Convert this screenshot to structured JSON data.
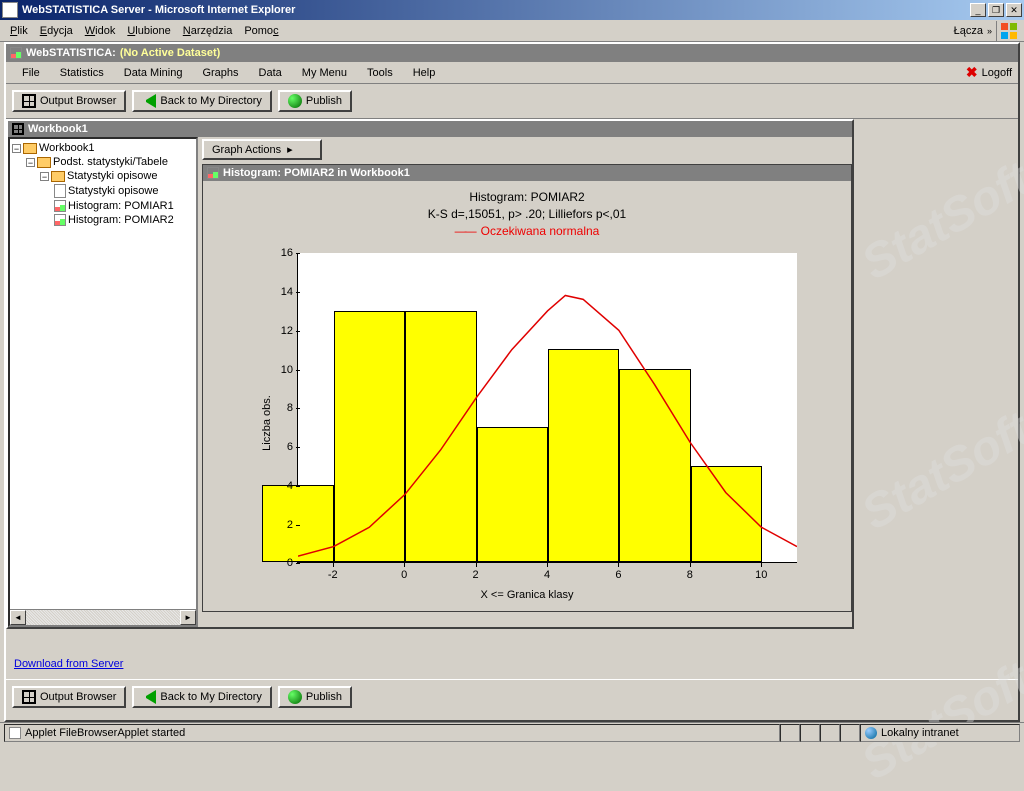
{
  "browser": {
    "title": "WebSTATISTICA Server - Microsoft Internet Explorer",
    "menu": [
      "Plik",
      "Edycja",
      "Widok",
      "Ulubione",
      "Narzędzia",
      "Pomoc"
    ],
    "links_label": "Łącza",
    "status_text": "Applet FileBrowserApplet started",
    "zone": "Lokalny intranet"
  },
  "app": {
    "title_prefix": "WebSTATISTICA:",
    "title_suffix": "(No Active Dataset)",
    "menu": [
      "File",
      "Statistics",
      "Data Mining",
      "Graphs",
      "Data",
      "My Menu",
      "Tools",
      "Help"
    ],
    "logoff": "Logoff"
  },
  "toolbar": {
    "output_browser": "Output Browser",
    "back": "Back to My Directory",
    "publish": "Publish"
  },
  "workbook": {
    "title": "Workbook1",
    "graph_actions": "Graph Actions",
    "tree": {
      "root": "Workbook1",
      "n1": "Podst. statystyki/Tabele",
      "n2": "Statystyki opisowe",
      "n3": "Statystyki opisowe",
      "n4": "Histogram: POMIAR1",
      "n5": "Histogram: POMIAR2"
    }
  },
  "graph": {
    "window_title": "Histogram: POMIAR2 in Workbook1",
    "title": "Histogram: POMIAR2",
    "subtitle": "K-S d=,15051, p> .20; Lilliefors p<,01",
    "legend": "Oczekiwana normalna",
    "ylabel": "Liczba obs.",
    "xlabel": "X <= Granica klasy"
  },
  "link": {
    "download": "Download from Server"
  },
  "watermark": "StatSoft",
  "chart_data": {
    "type": "bar",
    "categories": [
      -2,
      0,
      2,
      4,
      6,
      8,
      10
    ],
    "values": [
      4,
      13,
      13,
      7,
      11,
      10,
      5
    ],
    "title": "Histogram: POMIAR2",
    "xlabel": "X <= Granica klasy",
    "ylabel": "Liczba obs.",
    "ylim": [
      0,
      16
    ],
    "xlim": [
      -3,
      11
    ],
    "overlay": {
      "name": "Oczekiwana normalna",
      "type": "line",
      "color": "#e00000",
      "x": [
        -3,
        -2,
        -1,
        0,
        1,
        2,
        3,
        4,
        4.5,
        5,
        6,
        7,
        8,
        9,
        10,
        11
      ],
      "y": [
        0.3,
        0.8,
        1.8,
        3.5,
        5.8,
        8.5,
        11.0,
        13.0,
        13.8,
        13.6,
        12.0,
        9.2,
        6.2,
        3.6,
        1.8,
        0.8
      ]
    },
    "yticks": [
      0,
      2,
      4,
      6,
      8,
      10,
      12,
      14,
      16
    ],
    "xticks": [
      -2,
      0,
      2,
      4,
      6,
      8,
      10
    ]
  }
}
